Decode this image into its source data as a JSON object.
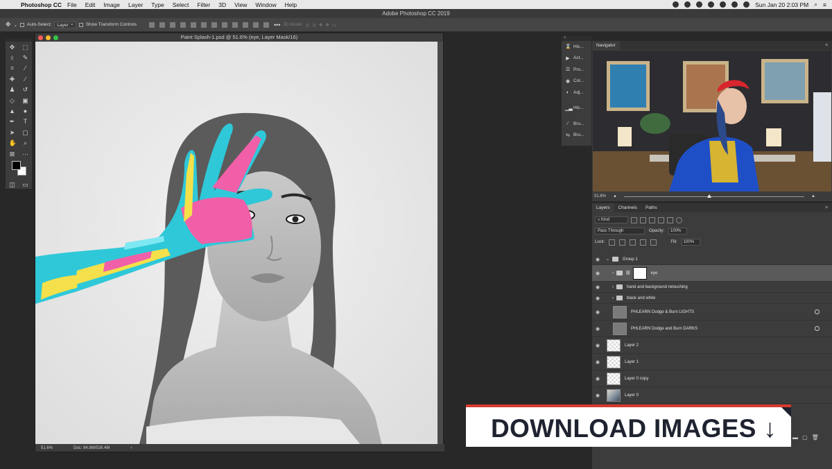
{
  "menubar": {
    "app_name": "Photoshop CC",
    "items": [
      "File",
      "Edit",
      "Image",
      "Layer",
      "Type",
      "Select",
      "Filter",
      "3D",
      "View",
      "Window",
      "Help"
    ],
    "datetime": "Sun Jan 20  2:03 PM"
  },
  "app_title": "Adobe Photoshop CC 2019",
  "options": {
    "auto_select_label": "Auto-Select:",
    "auto_select_value": "Layer",
    "transform_label": "Show Transform Controls",
    "mode_3d_label": "3D Mode:"
  },
  "document": {
    "title": "Paint Splash-1.psd @ 51.6% (eye, Layer Mask/16)",
    "zoom": "51.6%",
    "doc_size": "Doc: 84.8M/526.4M"
  },
  "side_panels": [
    {
      "icon": "history-icon",
      "label": "His..."
    },
    {
      "icon": "actions-icon",
      "label": "Act..."
    },
    {
      "icon": "properties-icon",
      "label": "Pro..."
    },
    {
      "icon": "color-icon",
      "label": "Col..."
    },
    {
      "icon": "adjustments-icon",
      "label": "Adj..."
    },
    {
      "icon": "histogram-icon",
      "label": "His..."
    },
    {
      "icon": "brushes-icon",
      "label": "Bru..."
    },
    {
      "icon": "brush-settings-icon",
      "label": "Bru..."
    }
  ],
  "navigator": {
    "tab": "Navigator",
    "zoom": "51.6%"
  },
  "layers_panel": {
    "tabs": [
      "Layers",
      "Channels",
      "Paths"
    ],
    "kind_label": "Kind",
    "blend_mode": "Pass Through",
    "opacity_label": "Opacity:",
    "opacity_value": "100%",
    "lock_label": "Lock:",
    "fill_label": "Fill:",
    "fill_value": "100%",
    "layers": [
      {
        "name": "Group 1",
        "type": "group"
      },
      {
        "name": "eye",
        "type": "group-mask",
        "selected": true
      },
      {
        "name": "hand and background retouching",
        "type": "folder"
      },
      {
        "name": "black and white",
        "type": "folder"
      },
      {
        "name": "PHLEARN Dodge & Burn LIGHTS",
        "type": "adjust"
      },
      {
        "name": "PHLEARN Dodge and Burn DARKS",
        "type": "adjust"
      },
      {
        "name": "Layer 2",
        "type": "check"
      },
      {
        "name": "Layer 1",
        "type": "check"
      },
      {
        "name": "Layer 0 copy",
        "type": "check"
      },
      {
        "name": "Layer 0",
        "type": "photo"
      }
    ]
  },
  "banner": {
    "text": "DOWNLOAD IMAGES ↓"
  },
  "colors": {
    "banner_accent": "#d73a2e",
    "banner_text": "#1f2330",
    "paint_cyan": "#2ec8d8",
    "paint_pink": "#f05fa8",
    "paint_yellow": "#f3e04a"
  }
}
